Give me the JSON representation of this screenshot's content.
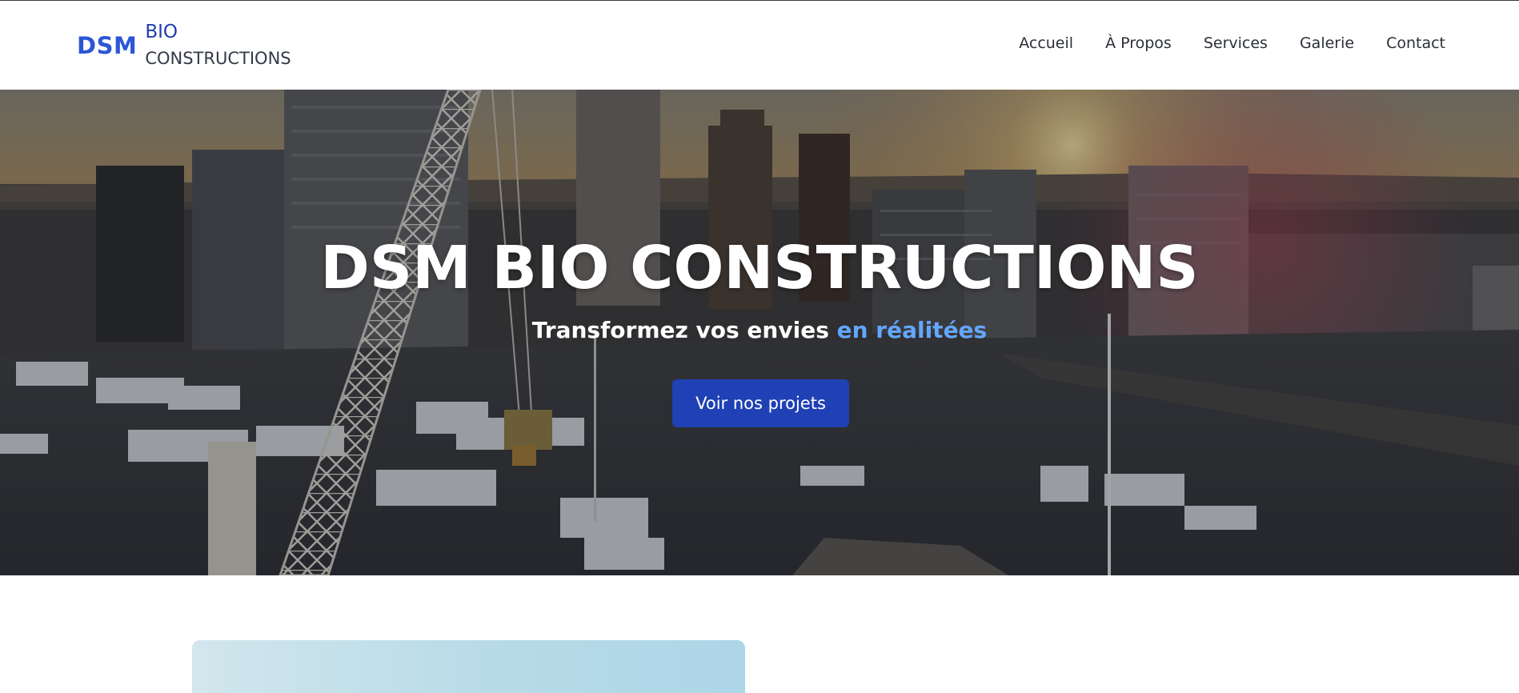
{
  "brand": {
    "dsm": "DSM",
    "bio": "BIO",
    "constructions": "CONSTRUCTIONS"
  },
  "nav": {
    "items": [
      "Accueil",
      "À Propos",
      "Services",
      "Galerie",
      "Contact"
    ]
  },
  "hero": {
    "title": "DSM BIO CONSTRUCTIONS",
    "subtitle_main": "Transformez vos envies",
    "subtitle_accent": "en réalitées",
    "cta_label": "Voir nos projets"
  },
  "colors": {
    "brand_blue": "#2b57d6",
    "cta_blue": "#1f41b5",
    "accent_light_blue": "#63a6ff"
  }
}
